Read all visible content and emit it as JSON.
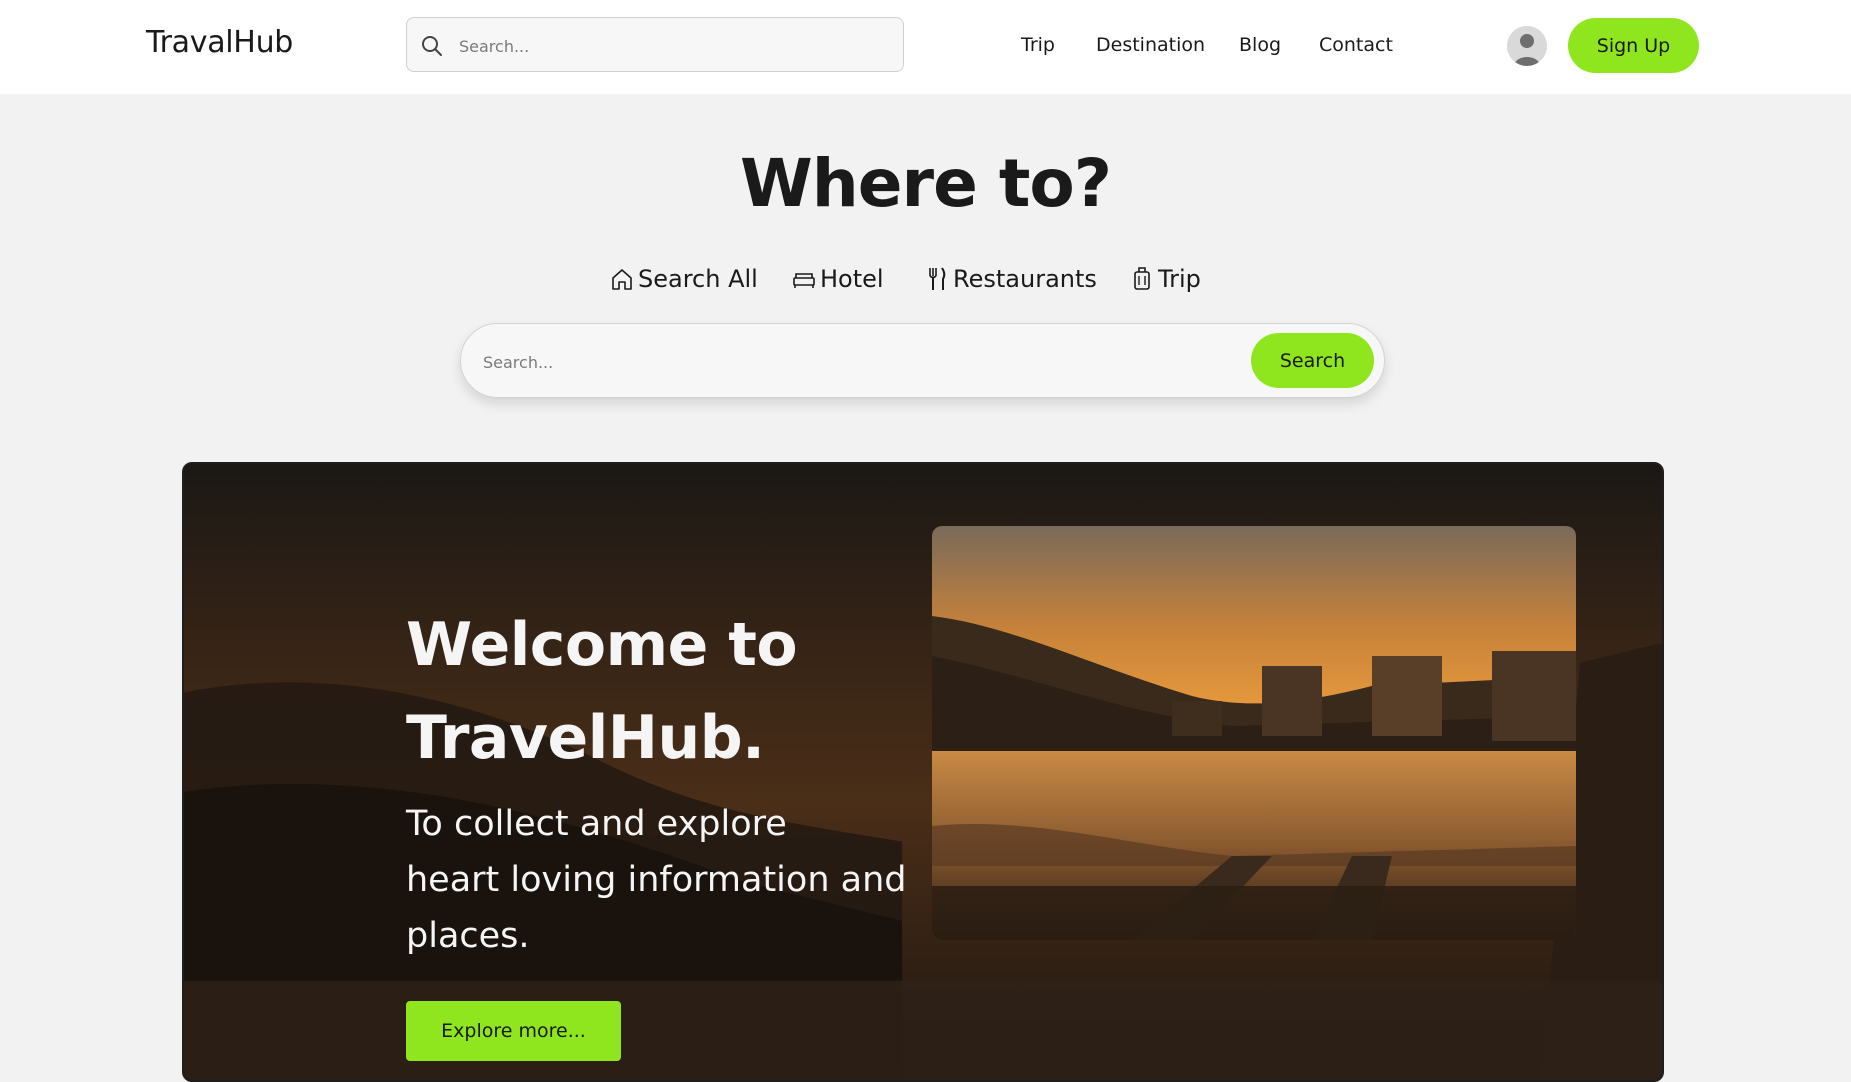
{
  "header": {
    "logo": "TravalHub",
    "search_placeholder": "Search...",
    "nav": [
      "Trip",
      "Destination",
      "Blog",
      "Contact"
    ],
    "signup_label": "Sign Up",
    "avatar_icon": "user-avatar-icon"
  },
  "hero": {
    "title": "Where to?",
    "tabs": [
      {
        "label": "Search All",
        "icon": "home-icon"
      },
      {
        "label": "Hotel",
        "icon": "bed-icon"
      },
      {
        "label": "Restaurants",
        "icon": "fork-knife-icon"
      },
      {
        "label": "Trip",
        "icon": "luggage-icon"
      }
    ],
    "search_placeholder": "Search...",
    "search_button": "Search"
  },
  "banner": {
    "welcome_line1": "Welcome to",
    "welcome_line2": "TravelHub.",
    "tagline_line1": "To collect and explore",
    "tagline_line2": "heart loving information and",
    "tagline_line3": "places.",
    "explore_button": "Explore more..."
  },
  "colors": {
    "accent": "#8fe61e",
    "page_bg": "#f2f2f2",
    "header_bg": "#ffffff",
    "text": "#1a1a1a"
  }
}
